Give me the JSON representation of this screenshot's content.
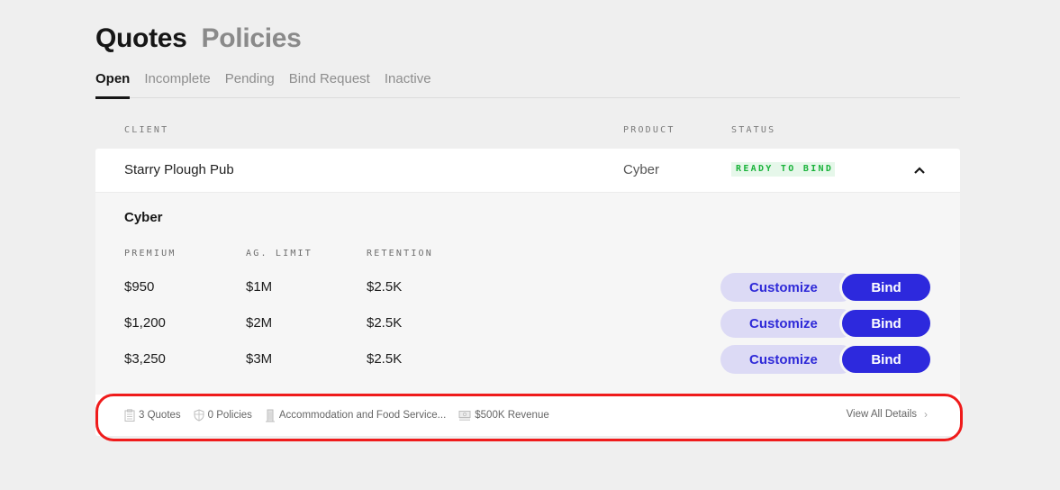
{
  "header": {
    "titles": [
      {
        "label": "Quotes",
        "active": true
      },
      {
        "label": "Policies",
        "active": false
      }
    ]
  },
  "tabs": [
    {
      "label": "Open",
      "active": true
    },
    {
      "label": "Incomplete",
      "active": false
    },
    {
      "label": "Pending",
      "active": false
    },
    {
      "label": "Bind Request",
      "active": false
    },
    {
      "label": "Inactive",
      "active": false
    }
  ],
  "table": {
    "columns": {
      "client": "CLIENT",
      "product": "PRODUCT",
      "status": "STATUS"
    },
    "rows": [
      {
        "client": "Starry Plough Pub",
        "product": "Cyber",
        "status": "READY TO BIND",
        "status_color": "#19b33a",
        "expanded": true,
        "expand_icon": "chevron-up-icon",
        "detail": {
          "product_title": "Cyber",
          "columns": {
            "premium": "PREMIUM",
            "limit": "AG. LIMIT",
            "retention": "RETENTION"
          },
          "quotes": [
            {
              "premium": "$950",
              "limit": "$1M",
              "retention": "$2.5K",
              "customize_label": "Customize",
              "bind_label": "Bind"
            },
            {
              "premium": "$1,200",
              "limit": "$2M",
              "retention": "$2.5K",
              "customize_label": "Customize",
              "bind_label": "Bind"
            },
            {
              "premium": "$3,250",
              "limit": "$3M",
              "retention": "$2.5K",
              "customize_label": "Customize",
              "bind_label": "Bind"
            }
          ]
        },
        "footer": {
          "meta": [
            {
              "icon": "clipboard-icon",
              "label": "3 Quotes"
            },
            {
              "icon": "shield-icon",
              "label": "0 Policies"
            },
            {
              "icon": "building-icon",
              "label": "Accommodation and Food Service..."
            },
            {
              "icon": "cash-icon",
              "label": "$500K Revenue"
            }
          ],
          "view_all_label": "View All Details",
          "view_all_icon": "chevron-right-icon"
        }
      }
    ]
  },
  "colors": {
    "accent": "#2d29dd",
    "accent_light": "#dcdaf5",
    "status_green": "#19b33a",
    "status_green_bg": "#e6f7ea",
    "highlight": "#ef1b1b"
  }
}
